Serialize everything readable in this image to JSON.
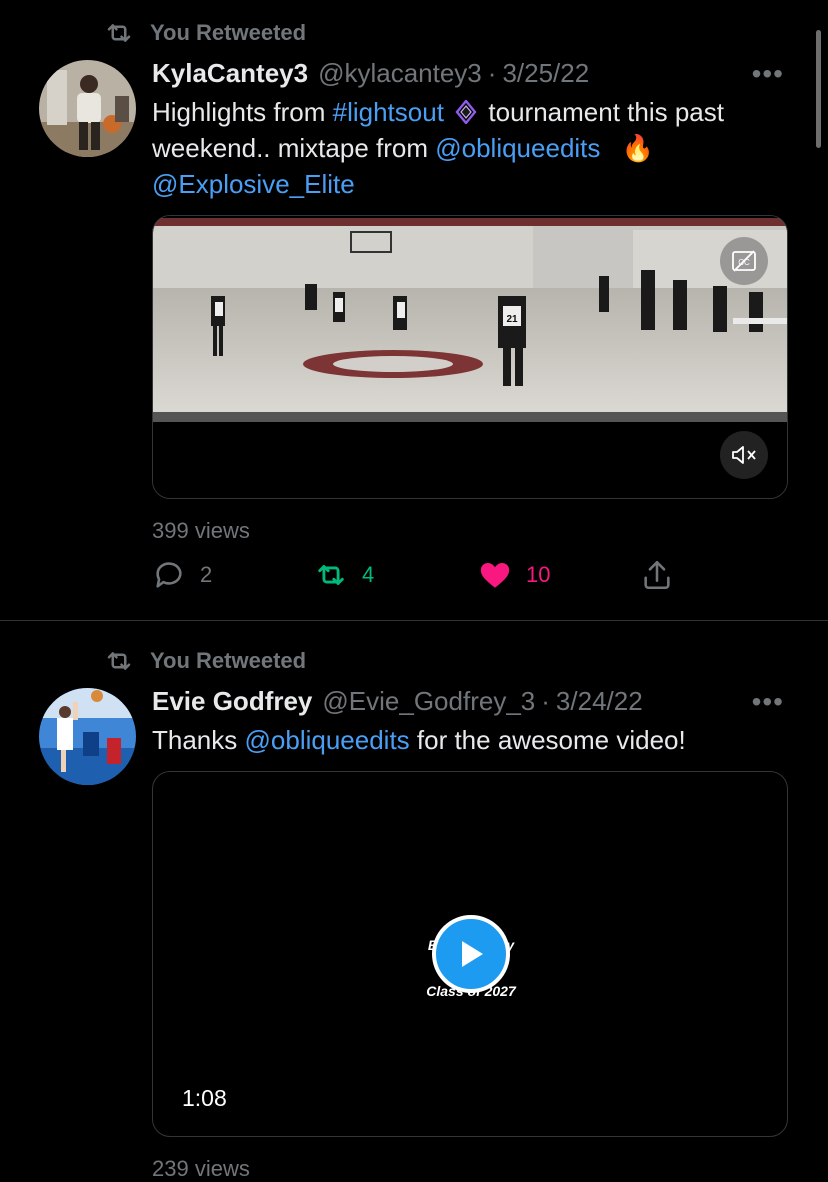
{
  "tweets": [
    {
      "retweet_label": "You Retweeted",
      "name": "KylaCantey3",
      "handle": "@kylacantey3",
      "separator": "·",
      "date": "3/25/22",
      "more": "•••",
      "text_parts": {
        "p1": "Highlights from ",
        "hashtag": "#lightsout",
        "p2": " tournament this past weekend.. mixtape from ",
        "mention1": "@obliqueedits",
        "emoji": "🔥",
        "mention2": "@Explosive_Elite"
      },
      "views": "399 views",
      "replies": "2",
      "retweets": "4",
      "likes": "10",
      "jersey_number": "21"
    },
    {
      "retweet_label": "You Retweeted",
      "name": "Evie Godfrey",
      "handle": "@Evie_Godfrey_3",
      "separator": "·",
      "date": "3/24/22",
      "more": "•••",
      "text_parts": {
        "p1": "Thanks ",
        "mention1": "@obliqueedits",
        "p2": " for the awesome video!"
      },
      "video_overlay_line1": "Evie Godfrey",
      "video_overlay_line2": "Class of 2027",
      "duration": "1:08",
      "views": "239 views"
    }
  ],
  "colors": {
    "background": "#000000",
    "secondary_text": "#71767b",
    "link": "#4a9ff5",
    "retweet_green": "#00ba7c",
    "like_pink": "#f91880",
    "play_blue": "#1d9bf0"
  }
}
